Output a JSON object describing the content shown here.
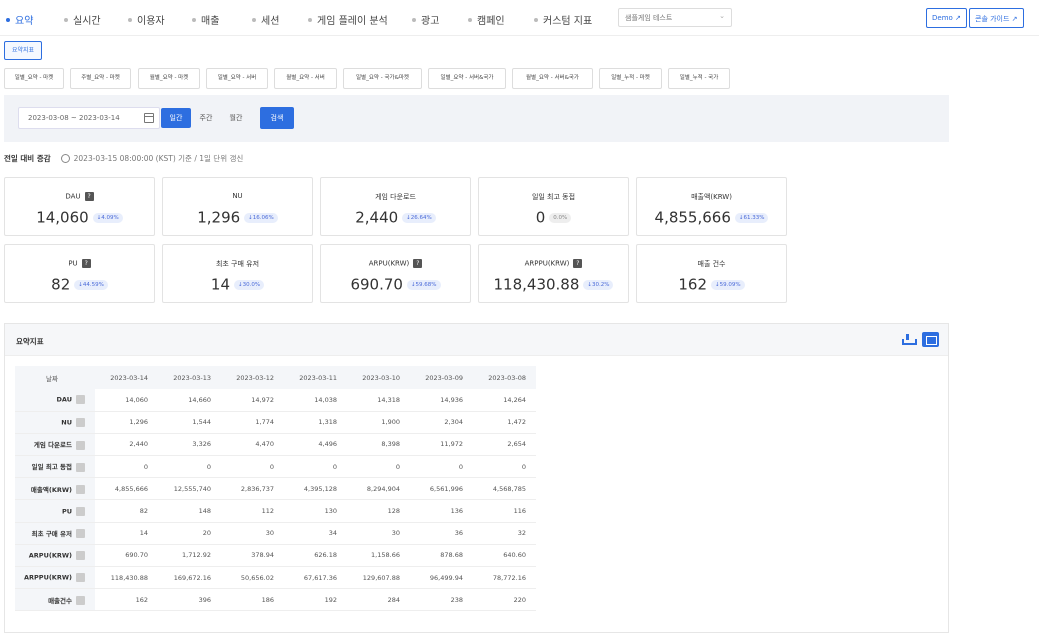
{
  "nav": {
    "items": [
      "요약",
      "실시간",
      "이용자",
      "매출",
      "세션",
      "게임 플레이 분석",
      "광고",
      "캠페인",
      "커스텀 지표"
    ],
    "game_select": "샘플게임 테스트",
    "demo_label": "Demo",
    "guide_label": "콘솔 가이드"
  },
  "subtab": "요약지표",
  "reports": [
    "일별_요약 - 마켓",
    "주별_요약 - 마켓",
    "월별_요약 - 마켓",
    "일별_요약 - 서버",
    "월별_요약 - 서버",
    "일별_요약 - 국가&마켓",
    "일별_요약 - 서버&국가",
    "월별_요약 - 서버&국가",
    "일별_누적 - 마켓",
    "일별_누적 - 국가"
  ],
  "filter": {
    "date_range": "2023-03-08 ~ 2023-03-14",
    "periods": [
      "일간",
      "주간",
      "월간"
    ],
    "search": "검색"
  },
  "summary": {
    "title": "전일 대비 증감",
    "updated": "2023-03-15 08:00:00 (KST) 기준 / 1일 단위 갱신"
  },
  "cards": [
    {
      "label": "DAU",
      "value": "14,060",
      "change": "↓4.09%",
      "help": true
    },
    {
      "label": "NU",
      "value": "1,296",
      "change": "↓16.06%",
      "help": false
    },
    {
      "label": "게임 다운로드",
      "value": "2,440",
      "change": "↓26.64%",
      "help": false
    },
    {
      "label": "일일 최고 동접",
      "value": "0",
      "change": "0.0%",
      "help": false
    },
    {
      "label": "매출액(KRW)",
      "value": "4,855,666",
      "change": "↓61.33%",
      "help": false
    },
    {
      "label": "PU",
      "value": "82",
      "change": "↓44.59%",
      "help": true
    },
    {
      "label": "최초 구매 유저",
      "value": "14",
      "change": "↓30.0%",
      "help": false
    },
    {
      "label": "ARPU(KRW)",
      "value": "690.70",
      "change": "↓59.68%",
      "help": true
    },
    {
      "label": "ARPPU(KRW)",
      "value": "118,430.88",
      "change": "↓30.2%",
      "help": true
    },
    {
      "label": "매출 건수",
      "value": "162",
      "change": "↓59.09%",
      "help": false
    }
  ],
  "table": {
    "title": "요약지표",
    "header": "날짜",
    "dates": [
      "2023-03-14",
      "2023-03-13",
      "2023-03-12",
      "2023-03-11",
      "2023-03-10",
      "2023-03-09",
      "2023-03-08"
    ],
    "rows": [
      {
        "label": "DAU",
        "values": [
          "14,060",
          "14,660",
          "14,972",
          "14,038",
          "14,318",
          "14,936",
          "14,264"
        ]
      },
      {
        "label": "NU",
        "values": [
          "1,296",
          "1,544",
          "1,774",
          "1,318",
          "1,900",
          "2,304",
          "1,472"
        ]
      },
      {
        "label": "게임 다운로드",
        "values": [
          "2,440",
          "3,326",
          "4,470",
          "4,496",
          "8,398",
          "11,972",
          "2,654"
        ]
      },
      {
        "label": "일일 최고 동접",
        "values": [
          "0",
          "0",
          "0",
          "0",
          "0",
          "0",
          "0"
        ]
      },
      {
        "label": "매출액(KRW)",
        "values": [
          "4,855,666",
          "12,555,740",
          "2,836,737",
          "4,395,128",
          "8,294,904",
          "6,561,996",
          "4,568,785"
        ]
      },
      {
        "label": "PU",
        "values": [
          "82",
          "148",
          "112",
          "130",
          "128",
          "136",
          "116"
        ]
      },
      {
        "label": "최초 구매 유저",
        "values": [
          "14",
          "20",
          "30",
          "34",
          "30",
          "36",
          "32"
        ]
      },
      {
        "label": "ARPU(KRW)",
        "values": [
          "690.70",
          "1,712.92",
          "378.94",
          "626.18",
          "1,158.66",
          "878.68",
          "640.60"
        ]
      },
      {
        "label": "ARPPU(KRW)",
        "values": [
          "118,430.88",
          "169,672.16",
          "50,656.02",
          "67,617.36",
          "129,607.88",
          "96,499.94",
          "78,772.16"
        ]
      },
      {
        "label": "매출건수",
        "values": [
          "162",
          "396",
          "186",
          "192",
          "284",
          "238",
          "220"
        ]
      }
    ]
  }
}
